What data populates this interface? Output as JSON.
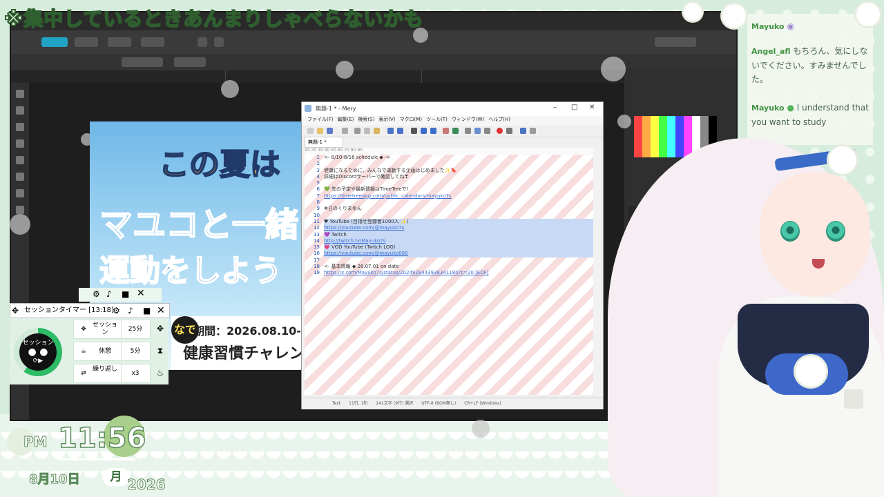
{
  "caption": "※集中しているときあんまりしゃべらないかも",
  "editor": {
    "title": "無題-1 * - Mery",
    "menus": [
      "ファイル(F)",
      "編集(E)",
      "検索(S)",
      "表示(V)",
      "マクロ(M)",
      "ツール(T)",
      "ウィンドウ(W)",
      "ヘルプ(H)"
    ],
    "tab": "無題-1 *",
    "ruler": "10        20        30        40        50        60        70        80        90",
    "lines": [
      "<- 8/10-8/16 schedule ◆ ->",
      "",
      "健康になるために、みんなで運動する企画はじめました✨🔖",
      "詳細はDiscordサーバーで確認してね❣",
      "",
      "💚 先の予定や最新情報はTimeTreeで！",
      "https://timetreeapp.com/public_calendars/mayuko7s",
      "",
      "#日のくりまゆん",
      "",
      "♥ YouTube (目指せ登録者1000人 ✨)",
      "  https://youtube.com/@mayuko7s",
      "💜 Twitch",
      "  http://twitch.tv/Mayuko7s",
      "💗 VOD YouTube (Twitch LOG)",
      "  https://youtube.com/@mayuko000",
      "",
      "<- 基本情報 ◆ 26.07.01 on date",
      "https://x.com/Mayuko7s/status/2024928443938341180?s=20 [EOF]"
    ],
    "status": [
      "Text",
      "11行, 1桁",
      "241文字 (9行) 選択",
      "UTF-8 (BOM無し)",
      "CR+LF (Windows)"
    ]
  },
  "poster": {
    "line1": "この夏は",
    "line2": "マユコと一緒",
    "line3": "運動をしよう",
    "date": "期間：2026.08.10-",
    "habit": "健康習慣チャレン",
    "badge": "なで"
  },
  "timer": {
    "title": "セッションタイマー [13:18]",
    "center_label": "セッション",
    "rows": [
      {
        "icon": "✥",
        "label": "セッション",
        "value": "25分"
      },
      {
        "icon": "☕",
        "label": "休憩",
        "value": "5分"
      },
      {
        "icon": "⇄",
        "label": "繰り返し",
        "value": "x3"
      }
    ],
    "progress": 0.6
  },
  "clock": {
    "ampm": "PM",
    "time": "11:56",
    "date": "8月10日",
    "day": "月",
    "year": "2026"
  },
  "chat": [
    {
      "name": "Mayuko",
      "text": ""
    },
    {
      "name": "Angel_afl",
      "text": "もちろん、気にしないでください。すみませんでした。"
    },
    {
      "name": "Mayuko",
      "text": "I understand that you want to study"
    }
  ],
  "colors": {
    "accent": "#21a3c5",
    "chat_name": "#3b8f3b",
    "link": "#3c6fd6"
  }
}
